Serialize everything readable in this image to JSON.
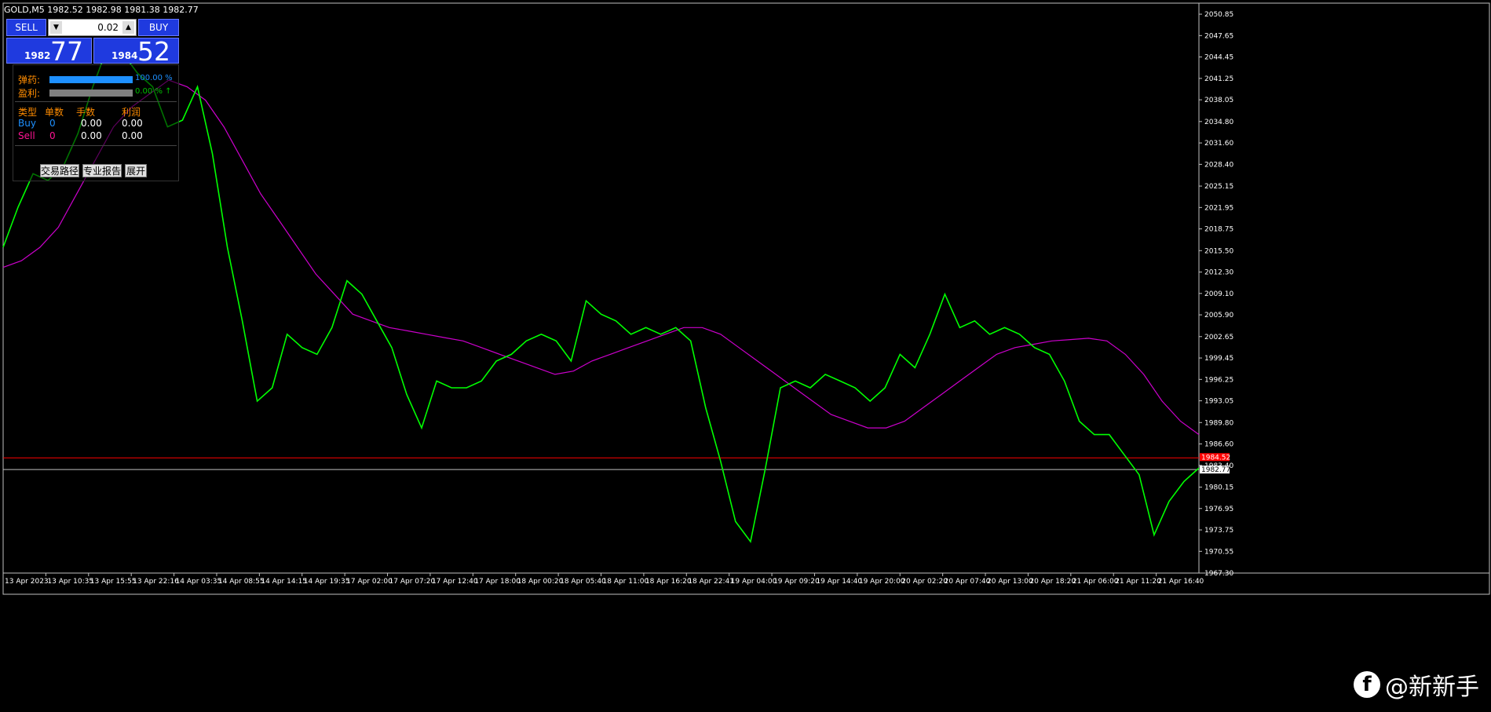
{
  "header": {
    "symbol_title": "GOLD,M5  1982.52 1982.98 1981.38 1982.77"
  },
  "trade_panel": {
    "sell_label": "SELL",
    "buy_label": "BUY",
    "lot_value": "0.02",
    "sell_small": "1982",
    "sell_big": "77",
    "buy_small": "1984",
    "buy_big": "52"
  },
  "info_panel": {
    "ammo_label": "弹药:",
    "ammo_value": "100.00 %",
    "ammo_fraction": 1.0,
    "profit_label": "盈利:",
    "profit_value": "0.00 % ↑",
    "profit_fraction": 1.0,
    "col_type": "类型",
    "col_orders": "单数",
    "col_lots": "手数",
    "col_profit": "利润",
    "buy_label": "Buy",
    "buy_orders": "0",
    "buy_lots": "0.00",
    "buy_profit": "0.00",
    "sell_label": "Sell",
    "sell_orders": "0",
    "sell_lots": "0.00",
    "sell_profit": "0.00",
    "btn_path": "交易路径",
    "btn_report": "专业报告",
    "btn_expand": "展开"
  },
  "colors": {
    "background": "#000000",
    "candle": "#00ff00",
    "ma": "#cc00cc",
    "ask_line": "#ff0000",
    "bid_line": "#c0c0c0",
    "trade_line": "#0000ff",
    "button_blue": "#1f3adf"
  },
  "watermark": {
    "icon": "facebook-icon",
    "text": "@新新手"
  },
  "chart_data": {
    "type": "line",
    "title": "",
    "xlabel": "",
    "ylabel": "",
    "ylim": [
      1967.3,
      2052.5
    ],
    "grid": false,
    "y_ticks": [
      "2050.85",
      "2047.65",
      "2044.45",
      "2041.25",
      "2038.05",
      "2034.80",
      "2031.60",
      "2028.40",
      "2025.15",
      "2021.95",
      "2018.75",
      "2015.50",
      "2012.30",
      "2009.10",
      "2005.90",
      "2002.65",
      "1999.45",
      "1996.25",
      "1993.05",
      "1989.80",
      "1986.60",
      "1983.40",
      "1980.15",
      "1976.95",
      "1973.75",
      "1970.55",
      "1967.30"
    ],
    "x_ticks": [
      "13 Apr 2023",
      "13 Apr 10:35",
      "13 Apr 15:55",
      "13 Apr 22:16",
      "14 Apr 03:35",
      "14 Apr 08:55",
      "14 Apr 14:15",
      "14 Apr 19:35",
      "17 Apr 02:00",
      "17 Apr 07:20",
      "17 Apr 12:40",
      "17 Apr 18:00",
      "18 Apr 00:20",
      "18 Apr 05:40",
      "18 Apr 11:00",
      "18 Apr 16:20",
      "18 Apr 22:41",
      "19 Apr 04:00",
      "19 Apr 09:20",
      "19 Apr 14:40",
      "19 Apr 20:00",
      "20 Apr 02:20",
      "20 Apr 07:40",
      "20 Apr 13:00",
      "20 Apr 18:20",
      "21 Apr 06:00",
      "21 Apr 11:20",
      "21 Apr 16:40"
    ],
    "price_series": [
      2016,
      2022,
      2027,
      2026,
      2028,
      2033,
      2040,
      2046,
      2045,
      2042,
      2040,
      2034,
      2035,
      2040,
      2030,
      2016,
      2005,
      1993,
      1995,
      2003,
      2001,
      2000,
      2004,
      2011,
      2009,
      2005,
      2001,
      1994,
      1989,
      1996,
      1995,
      1995,
      1996,
      1999,
      2000,
      2002,
      2003,
      2002,
      1999,
      2008,
      2006,
      2005,
      2003,
      2004,
      2003,
      2004,
      2002,
      1992,
      1984,
      1975,
      1972,
      1983,
      1995,
      1996,
      1995,
      1997,
      1996,
      1995,
      1993,
      1995,
      2000,
      1998,
      2003,
      2009,
      2004,
      2005,
      2003,
      2004,
      2003,
      2001,
      2000,
      1996,
      1990,
      1988,
      1988,
      1985,
      1982,
      1973,
      1978,
      1981,
      1983
    ],
    "ma_series": [
      2013,
      2014,
      2016,
      2019,
      2024,
      2029,
      2034,
      2037,
      2039,
      2041,
      2040,
      2038,
      2034,
      2029,
      2024,
      2020,
      2016,
      2012,
      2009,
      2006,
      2005,
      2004,
      2003.5,
      2003,
      2002.5,
      2002,
      2001,
      2000,
      1999,
      1998,
      1997,
      1997.5,
      1999,
      2000,
      2001,
      2002,
      2003,
      2004,
      2004,
      2003,
      2001,
      1999,
      1997,
      1995,
      1993,
      1991,
      1990,
      1989,
      1989,
      1990,
      1992,
      1994,
      1996,
      1998,
      2000,
      2001,
      2001.5,
      2002,
      2002.2,
      2002.4,
      2002,
      2000,
      1997,
      1993,
      1990,
      1988
    ],
    "ask_price": 1984.52,
    "bid_price": 1982.77,
    "ask_label": "1984.52",
    "bid_label": "1982.77"
  }
}
